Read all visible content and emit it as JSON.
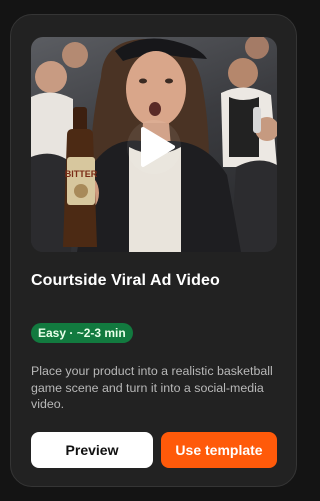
{
  "card": {
    "title": "Courtside Viral Ad Video",
    "badge": "Easy · ~2-3 min",
    "description": "Place your product into a realistic basketball game scene and turn it into a social-media video.",
    "thumbnail_label": "BITTER",
    "buttons": {
      "preview": "Preview",
      "use_template": "Use template"
    }
  },
  "colors": {
    "card_background": "#222222",
    "badge_green": "#127a3f",
    "accent_orange": "#ff5a0a"
  },
  "icons": {
    "play": "play-icon"
  }
}
